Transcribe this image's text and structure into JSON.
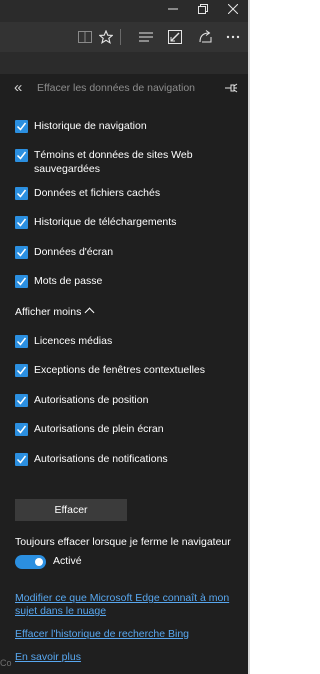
{
  "window": {
    "minimize_icon": "minimize-icon",
    "restore_icon": "restore-icon",
    "close_icon": "close-icon"
  },
  "toolbar": {
    "icons": [
      "reading-view-icon",
      "favorite-star-icon",
      "hub-icon",
      "web-note-icon",
      "share-icon",
      "more-icon"
    ]
  },
  "panel": {
    "title": "Effacer les données de navigation",
    "items_primary": [
      {
        "label": "Historique de navigation",
        "checked": true
      },
      {
        "label": "Témoins et données de sites Web sauvegardées",
        "checked": true
      },
      {
        "label": "Données et fichiers cachés",
        "checked": true
      },
      {
        "label": "Historique de téléchargements",
        "checked": true
      },
      {
        "label": "Données d'écran",
        "checked": true
      },
      {
        "label": "Mots de passe",
        "checked": true
      }
    ],
    "show_less": "Afficher moins",
    "items_more": [
      {
        "label": "Licences médias",
        "checked": true
      },
      {
        "label": "Exceptions de fenêtres contextuelles",
        "checked": true
      },
      {
        "label": "Autorisations de position",
        "checked": true
      },
      {
        "label": "Autorisations de plein écran",
        "checked": true
      },
      {
        "label": "Autorisations de notifications",
        "checked": true
      }
    ],
    "clear_button": "Effacer",
    "always_clear_label": "Toujours effacer lorsque je ferme le navigateur",
    "switch_state": "Activé",
    "switch_on": true,
    "links": {
      "modify": "Modifier ce que Microsoft Edge connaît à mon sujet dans le nuage",
      "bing_history": "Effacer l'historique de recherche Bing",
      "learn_more": "En savoir plus"
    }
  },
  "background_text": "Co",
  "colors": {
    "accent": "#2b8fe0",
    "link": "#58a7ef",
    "panel_bg": "#1f1f1f",
    "button_bg": "#3b3b3b"
  }
}
